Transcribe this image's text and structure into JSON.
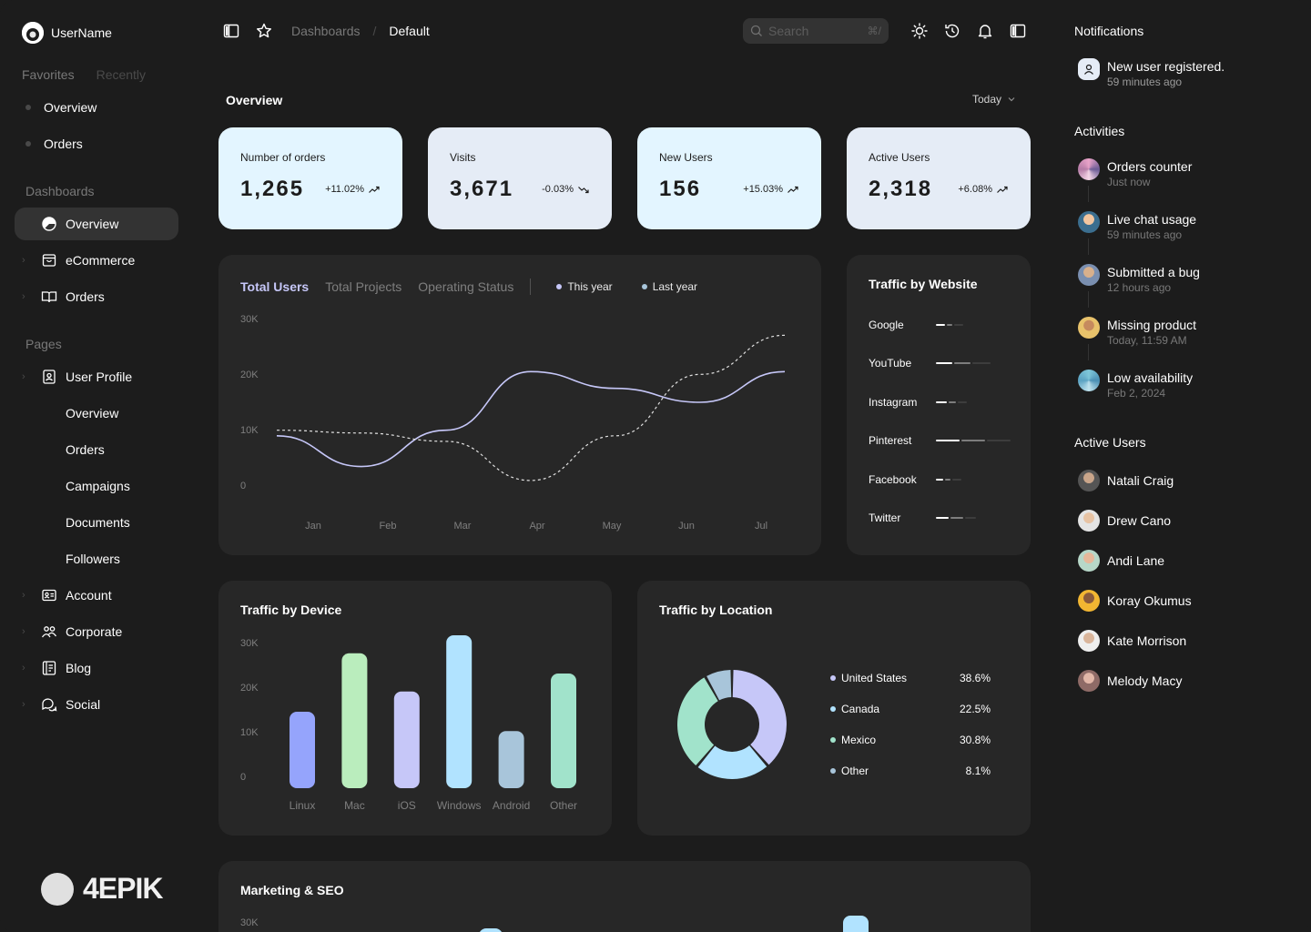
{
  "user": {
    "name": "UserName"
  },
  "favorites": {
    "tab_favorites": "Favorites",
    "tab_recently": "Recently",
    "items": [
      "Overview",
      "Orders"
    ]
  },
  "dashboards": {
    "title": "Dashboards",
    "items": [
      "Overview",
      "eCommerce",
      "Orders"
    ]
  },
  "pages": {
    "title": "Pages",
    "user_profile": "User Profile",
    "sub_items": [
      "Overview",
      "Orders",
      "Campaigns",
      "Documents",
      "Followers"
    ],
    "items": [
      "Account",
      "Corporate",
      "Blog",
      "Social"
    ]
  },
  "brand": {
    "logo_text": "4EPIK"
  },
  "header": {
    "crumb_root": "Dashboards",
    "crumb_sep": "/",
    "crumb_current": "Default",
    "search_placeholder": "Search",
    "search_shortcut": "⌘/"
  },
  "overview": {
    "title": "Overview",
    "range": "Today"
  },
  "kpis": [
    {
      "label": "Number of orders",
      "value": "1,265",
      "change": "+11.02%",
      "trend": "up"
    },
    {
      "label": "Visits",
      "value": "3,671",
      "change": "-0.03%",
      "trend": "down"
    },
    {
      "label": "New Users",
      "value": "156",
      "change": "+15.03%",
      "trend": "up"
    },
    {
      "label": "Active Users",
      "value": "2,318",
      "change": "+6.08%",
      "trend": "up"
    }
  ],
  "users_chart": {
    "tabs": [
      "Total Users",
      "Total Projects",
      "Operating Status"
    ],
    "legend": [
      "This year",
      "Last year"
    ]
  },
  "traffic_website": {
    "title": "Traffic by Website",
    "sites": [
      "Google",
      "YouTube",
      "Instagram",
      "Pinterest",
      "Facebook",
      "Twitter"
    ]
  },
  "traffic_device": {
    "title": "Traffic by Device"
  },
  "traffic_location": {
    "title": "Traffic by Location"
  },
  "marketing": {
    "title": "Marketing & SEO",
    "ytick_top": "30K"
  },
  "colors": {
    "accent": "#c6c7f8",
    "kpi_blue": "#e3f5ff",
    "kpi_gray": "#e5ecf6",
    "card": "#272727",
    "bg": "#1c1c1c"
  },
  "chart_data": [
    {
      "type": "line",
      "title": "Total Users",
      "categories": [
        "Jan",
        "Feb",
        "Mar",
        "Apr",
        "May",
        "Jun",
        "Jul"
      ],
      "yticks": [
        "30K",
        "20K",
        "10K",
        "0"
      ],
      "ylim": [
        0,
        30000
      ],
      "series": [
        {
          "name": "This year",
          "style": "solid",
          "values": [
            9000,
            3500,
            10000,
            20500,
            17500,
            15000,
            20500
          ]
        },
        {
          "name": "Last year",
          "style": "dashed",
          "values": [
            10000,
            9500,
            8000,
            1000,
            9000,
            20000,
            27000
          ]
        }
      ]
    },
    {
      "type": "bar",
      "title": "Traffic by Device",
      "categories": [
        "Linux",
        "Mac",
        "iOS",
        "Windows",
        "Android",
        "Other"
      ],
      "yticks": [
        "30K",
        "20K",
        "10K",
        "0"
      ],
      "ylim": [
        0,
        30000
      ],
      "values": [
        17000,
        30000,
        21500,
        34000,
        12700,
        25500
      ],
      "colors": [
        "#95a4fc",
        "#baedbd",
        "#c6c7f8",
        "#b1e3ff",
        "#a8c5da",
        "#a1e3cb"
      ]
    },
    {
      "type": "pie",
      "title": "Traffic by Location",
      "labels": [
        "United States",
        "Canada",
        "Mexico",
        "Other"
      ],
      "pct_labels": [
        "38.6%",
        "22.5%",
        "30.8%",
        "8.1%"
      ],
      "values": [
        38.6,
        22.5,
        30.8,
        8.1
      ],
      "colors": [
        "#c6c7f8",
        "#b1e3ff",
        "#a1e3cb",
        "#a8c5da"
      ]
    }
  ],
  "notifications": {
    "title": "Notifications",
    "items": [
      {
        "text": "New user registered.",
        "time": "59 minutes ago"
      }
    ]
  },
  "activities": {
    "title": "Activities",
    "items": [
      {
        "text": "Orders counter",
        "time": "Just now"
      },
      {
        "text": "Live chat usage",
        "time": "59 minutes ago"
      },
      {
        "text": "Submitted a bug",
        "time": "12 hours ago"
      },
      {
        "text": "Missing product",
        "time": "Today, 11:59 AM"
      },
      {
        "text": "Low availability",
        "time": "Feb 2, 2024"
      }
    ]
  },
  "active_users": {
    "title": "Active Users",
    "items": [
      "Natali Craig",
      "Drew Cano",
      "Andi Lane",
      "Koray Okumus",
      "Kate Morrison",
      "Melody Macy"
    ]
  }
}
